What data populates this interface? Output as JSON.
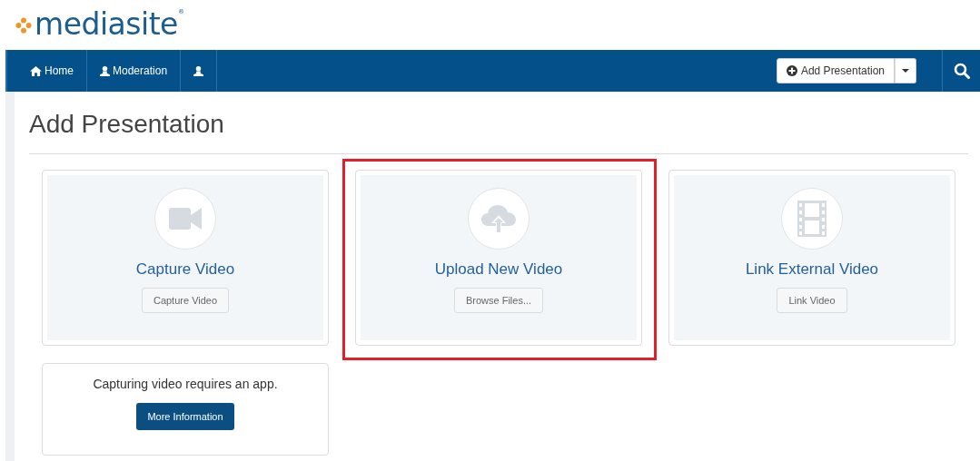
{
  "logo": {
    "text": "mediasite$^{®}$"
  },
  "nav": {
    "items": [
      {
        "kind": "home",
        "label": "Home"
      },
      {
        "kind": "user",
        "label": "Moderation"
      },
      {
        "kind": "user"
      }
    ],
    "add_button": {
      "label": "Add Presentation"
    }
  },
  "page_title": "Add Presentation",
  "options": [
    {
      "kind": "camera",
      "title": "Capture Video",
      "button": "Capture Video",
      "highlighted": false
    },
    {
      "kind": "upload",
      "title": "Upload New Video",
      "button": "Browse Files...",
      "highlighted": true
    },
    {
      "kind": "film",
      "title": "Link External Video",
      "button": "Link Video",
      "highlighted": false
    }
  ],
  "info": {
    "text": "Capturing video requires an app.",
    "button": "More Information"
  }
}
